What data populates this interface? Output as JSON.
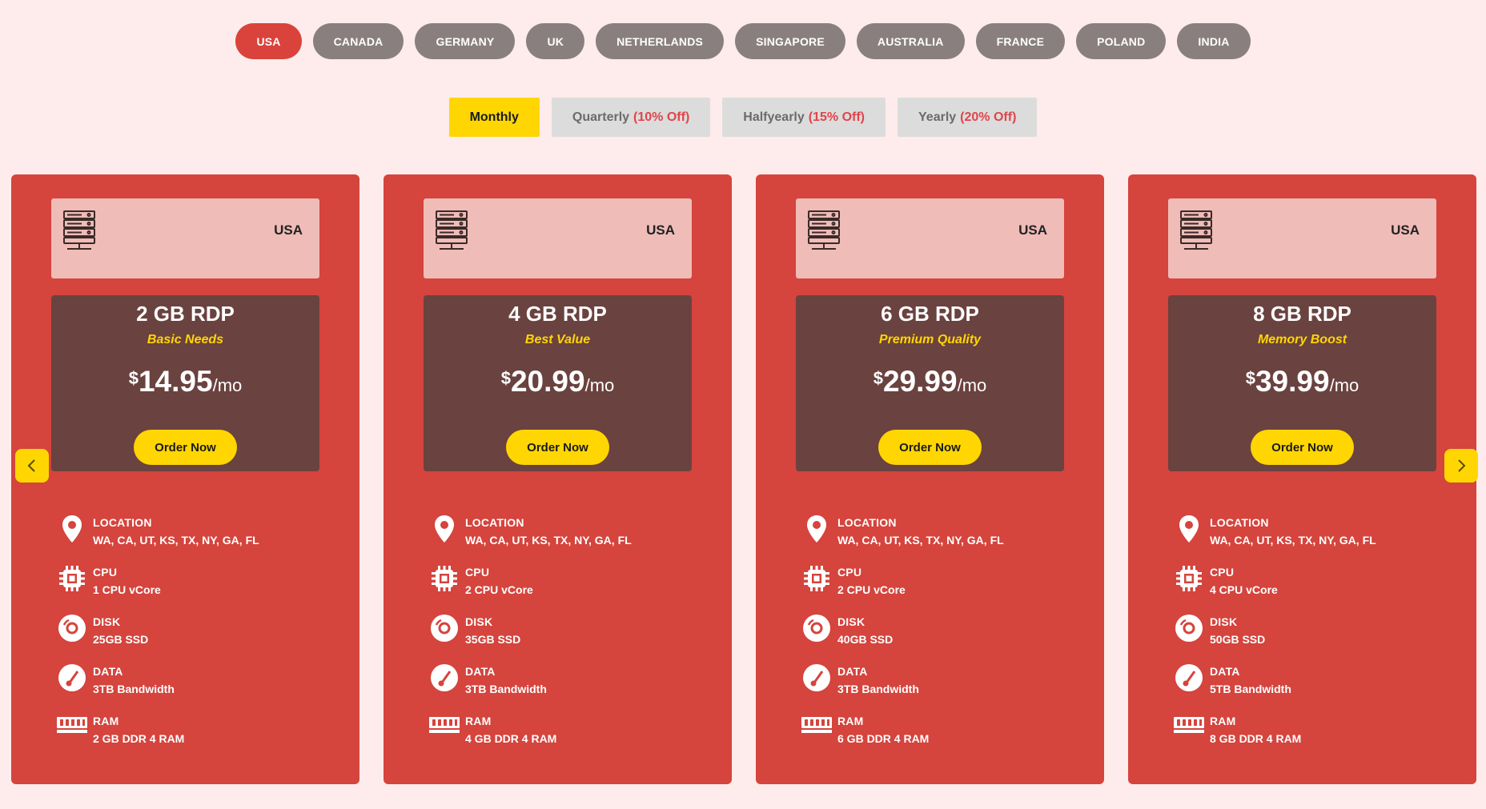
{
  "country_tabs": [
    "USA",
    "CANADA",
    "GERMANY",
    "UK",
    "NETHERLANDS",
    "SINGAPORE",
    "AUSTRALIA",
    "FRANCE",
    "POLAND",
    "INDIA"
  ],
  "active_country": "USA",
  "billing_tabs": [
    {
      "label": "Monthly",
      "discount": ""
    },
    {
      "label": "Quarterly",
      "discount": "(10% Off)"
    },
    {
      "label": "Halfyearly",
      "discount": "(15% Off)"
    },
    {
      "label": "Yearly",
      "discount": "(20% Off)"
    }
  ],
  "active_billing": "Monthly",
  "currency_symbol": "$",
  "per_label": "/mo",
  "order_label": "Order Now",
  "feature_labels": {
    "location": "LOCATION",
    "cpu": "CPU",
    "disk": "DISK",
    "data": "DATA",
    "ram": "RAM"
  },
  "plans": [
    {
      "country": "USA",
      "name": "2 GB RDP",
      "tagline": "Basic Needs",
      "price": "14.95",
      "location": "WA, CA, UT, KS, TX, NY, GA, FL",
      "cpu": "1 CPU vCore",
      "disk": "25GB SSD",
      "data": "3TB Bandwidth",
      "ram": "2 GB DDR 4 RAM"
    },
    {
      "country": "USA",
      "name": "4 GB RDP",
      "tagline": "Best Value",
      "price": "20.99",
      "location": "WA, CA, UT, KS, TX, NY, GA, FL",
      "cpu": "2 CPU vCore",
      "disk": "35GB SSD",
      "data": "3TB Bandwidth",
      "ram": "4 GB DDR 4 RAM"
    },
    {
      "country": "USA",
      "name": "6 GB RDP",
      "tagline": "Premium Quality",
      "price": "29.99",
      "location": "WA, CA, UT, KS, TX, NY, GA, FL",
      "cpu": "2 CPU vCore",
      "disk": "40GB SSD",
      "data": "3TB Bandwidth",
      "ram": "6 GB DDR 4 RAM"
    },
    {
      "country": "USA",
      "name": "8 GB RDP",
      "tagline": "Memory Boost",
      "price": "39.99",
      "location": "WA, CA, UT, KS, TX, NY, GA, FL",
      "cpu": "4 CPU vCore",
      "disk": "50GB SSD",
      "data": "5TB Bandwidth",
      "ram": "8 GB DDR 4 RAM"
    }
  ],
  "colors": {
    "background": "#fdeceb",
    "accent_red": "#d9433b",
    "card_red": "#d5443d",
    "price_box": "#6a423f",
    "yellow": "#ffd602",
    "tab_gray": "#8a7f7f"
  },
  "icons": {
    "prev": "chevron-left-icon",
    "next": "chevron-right-icon",
    "server": "server-icon",
    "location": "map-pin-icon",
    "cpu": "cpu-chip-icon",
    "disk": "disk-icon",
    "data": "gauge-icon",
    "ram": "ram-module-icon"
  }
}
